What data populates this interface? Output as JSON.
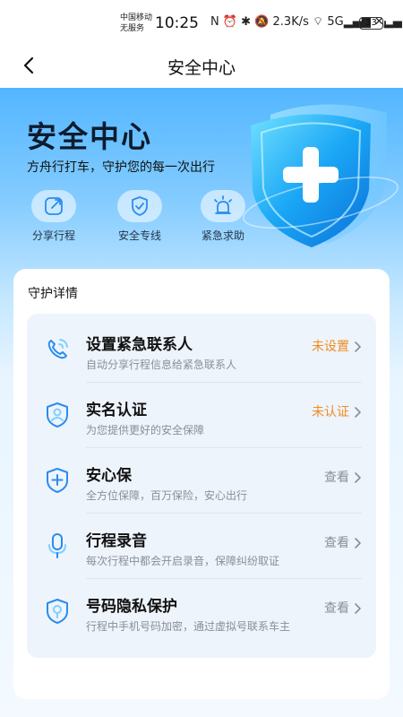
{
  "status_bar": {
    "carrier_line1": "中国移动",
    "carrier_line2": "无服务",
    "time": "10:25",
    "icons_text": "N ⏰ ✱ 🔕 2.3K/s  ⌔ 5G▂▄▆ ✕▂▄",
    "battery": "33"
  },
  "nav": {
    "title": "安全中心"
  },
  "hero": {
    "title": "安全中心",
    "subtitle": "方舟行打车，守护您的每一次出行"
  },
  "quick_actions": [
    {
      "label": "分享行程",
      "icon": "share-icon"
    },
    {
      "label": "安全专线",
      "icon": "shield-check-icon"
    },
    {
      "label": "紧急求助",
      "icon": "alarm-light-icon"
    }
  ],
  "card": {
    "title": "守护详情",
    "items": [
      {
        "title": "设置紧急联系人",
        "desc": "自动分享行程信息给紧急联系人",
        "status": "未设置",
        "status_color": "#f08b22",
        "icon": "phone-icon"
      },
      {
        "title": "实名认证",
        "desc": "为您提供更好的安全保障",
        "status": "未认证",
        "status_color": "#f08b22",
        "icon": "id-badge-icon"
      },
      {
        "title": "安心保",
        "desc": "全方位保障，百万保险，安心出行",
        "status": "查看",
        "status_color": "#8a8f97",
        "icon": "shield-plus-icon"
      },
      {
        "title": "行程录音",
        "desc": "每次行程中都会开启录音，保障纠纷取证",
        "status": "查看",
        "status_color": "#8a8f97",
        "icon": "microphone-icon"
      },
      {
        "title": "号码隐私保护",
        "desc": "行程中手机号码加密，通过虚拟号联系车主",
        "status": "查看",
        "status_color": "#8a8f97",
        "icon": "shield-lock-icon"
      }
    ]
  },
  "colors": {
    "accent_blue": "#2b8cf0",
    "warning_orange": "#f08b22"
  }
}
